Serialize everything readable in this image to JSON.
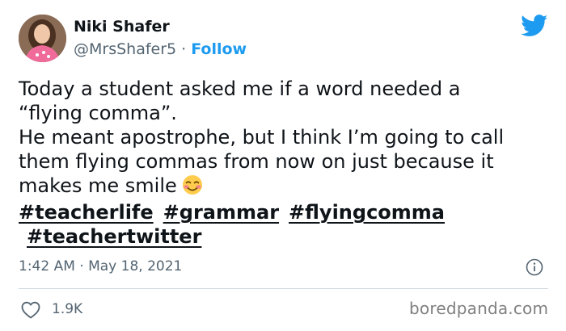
{
  "author": {
    "display_name": "Niki Shafer",
    "handle": "@MrsShafer5",
    "separator": "·",
    "follow_label": "Follow"
  },
  "brand_icon": "twitter-bird-icon",
  "tweet": {
    "line_1": "Today a student asked me if a word needed a",
    "line_2": "“flying comma”.",
    "line_3": "He meant apostrophe, but I think I’m going to call",
    "line_4": "them flying commas from now on just because it",
    "line_5": "makes me smile",
    "emoji": "smiling-face-with-smiling-eyes-emoji",
    "hashtags": [
      "#teacherlife",
      "#grammar",
      "#flyingcomma",
      "#teachertwitter"
    ]
  },
  "meta": {
    "timestamp": "1:42 AM · May 18, 2021"
  },
  "actions": {
    "like_count": "1.9K"
  },
  "watermark": "boredpanda.com",
  "colors": {
    "twitter_blue": "#1d9bf0",
    "text_primary": "#0f1419",
    "text_secondary": "#536471",
    "divider": "#cfd9de"
  }
}
